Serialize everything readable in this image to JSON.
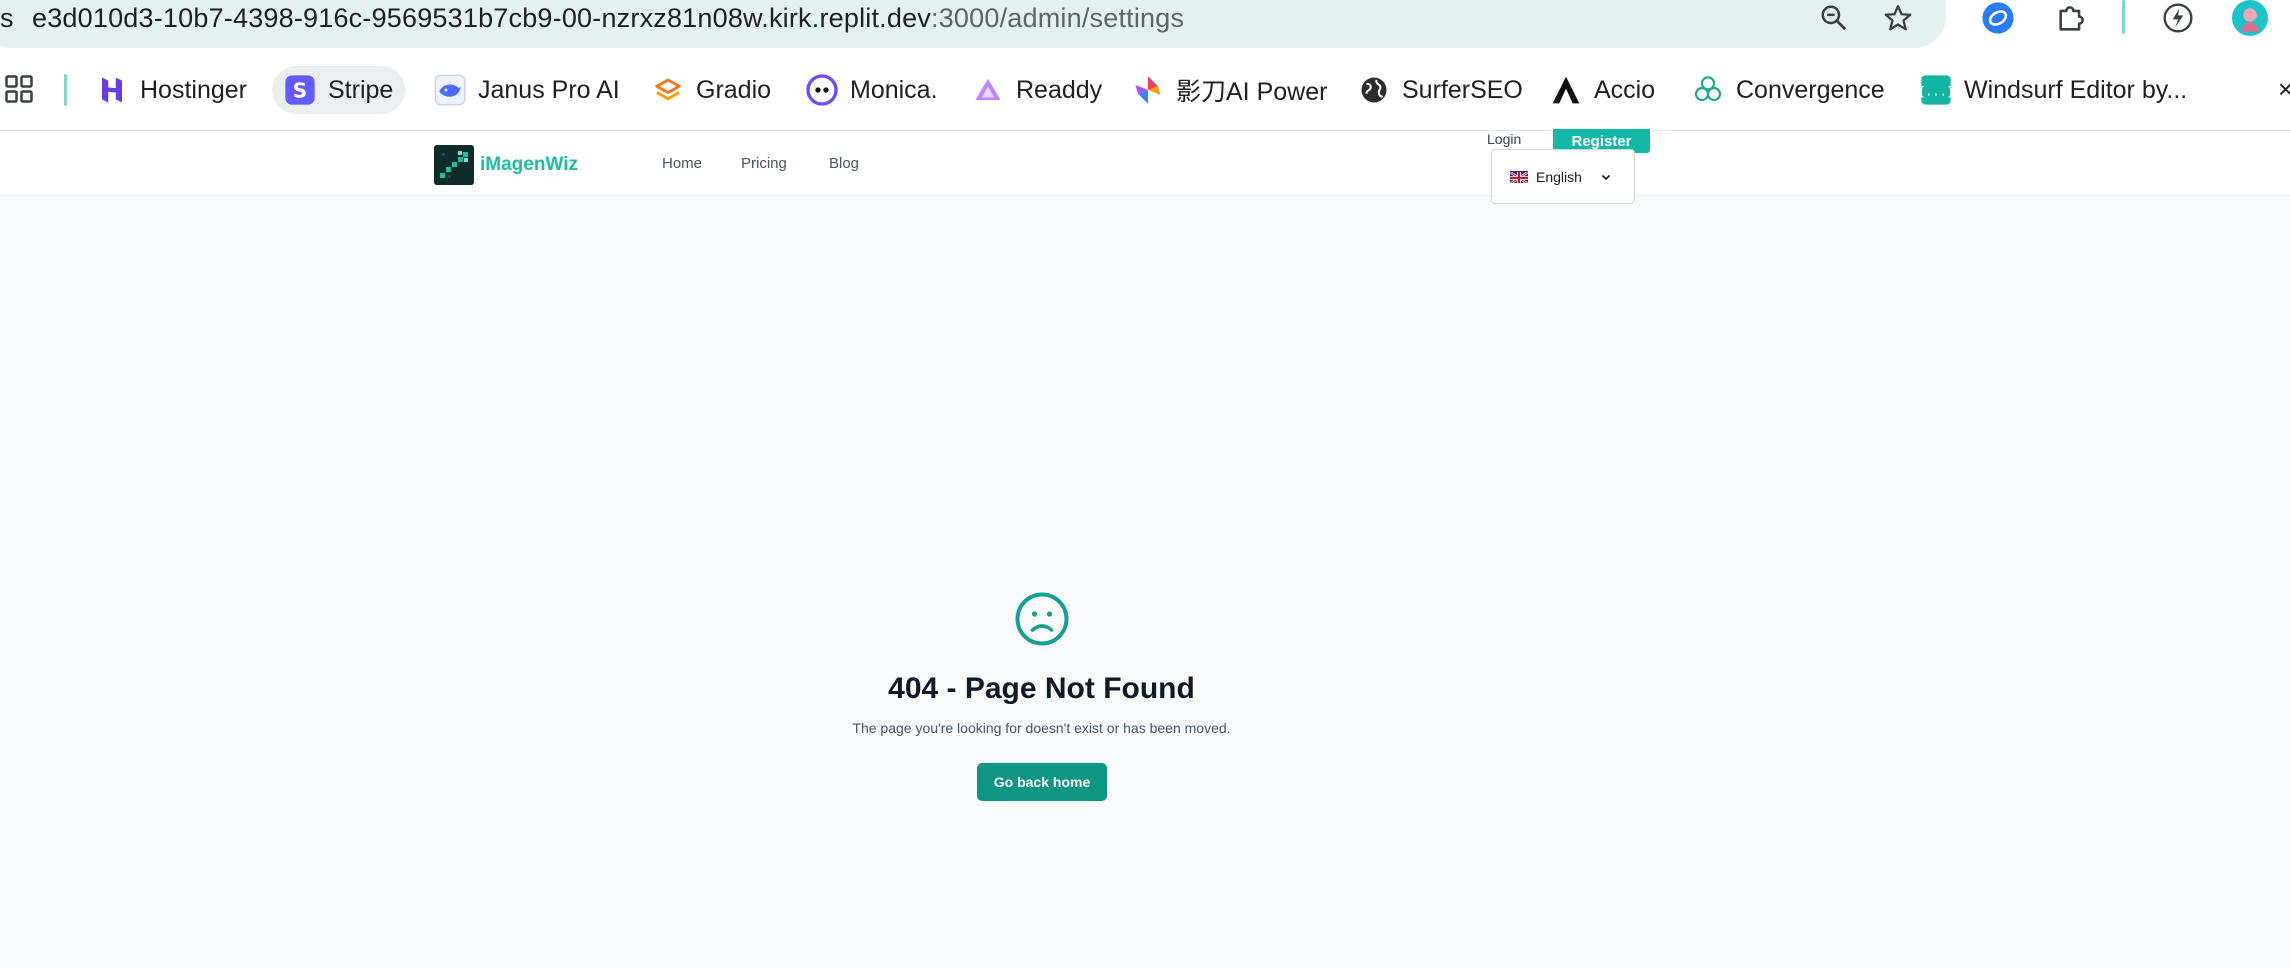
{
  "browser": {
    "url_lead": "s",
    "url_host": "e3d010d3-10b7-4398-916c-9569531b7cb9-00-nzrxz81n08w.kirk.replit.dev",
    "url_path": ":3000/admin/settings",
    "icons": [
      "zoom-out-icon",
      "bookmark-star-icon",
      "extension-circle-icon",
      "puzzle-extension-icon",
      "leaf-extension-icon",
      "profile-avatar-icon"
    ]
  },
  "bookmarks": [
    {
      "label": "Hostinger",
      "icon": "hostinger-icon",
      "color": "#673de6"
    },
    {
      "label": "Stripe",
      "icon": "stripe-icon",
      "color": "#635bff"
    },
    {
      "label": "Janus Pro AI",
      "icon": "janus-whale-icon",
      "color": "#4d6bfe"
    },
    {
      "label": "Gradio",
      "icon": "gradio-icon",
      "color": "#f97316"
    },
    {
      "label": "Monica.",
      "icon": "monica-icon",
      "color": "#6d4aff"
    },
    {
      "label": "Readdy",
      "icon": "readdy-icon",
      "color": "#a855f7"
    },
    {
      "label": "影刀AI Power",
      "icon": "yingdao-icon",
      "color": "#f43f5e"
    },
    {
      "label": "SurferSEO",
      "icon": "globe-icon",
      "color": "#222222"
    },
    {
      "label": "Accio",
      "icon": "accio-icon",
      "color": "#111111"
    },
    {
      "label": "Convergence",
      "icon": "convergence-icon",
      "color": "#1aa88c"
    },
    {
      "label": "Windsurf Editor by...",
      "icon": "windsurf-icon",
      "color": "#10b5a3"
    }
  ],
  "bookmarks_close": "×",
  "app": {
    "brand": "iMagenWiz",
    "nav": [
      "Home",
      "Pricing",
      "Blog"
    ],
    "login": "Login",
    "register": "Register",
    "language": "English",
    "accent": "#14b8a6"
  },
  "error": {
    "title": "404 - Page Not Found",
    "message": "The page you're looking for doesn't exist or has been moved.",
    "button": "Go back home"
  }
}
